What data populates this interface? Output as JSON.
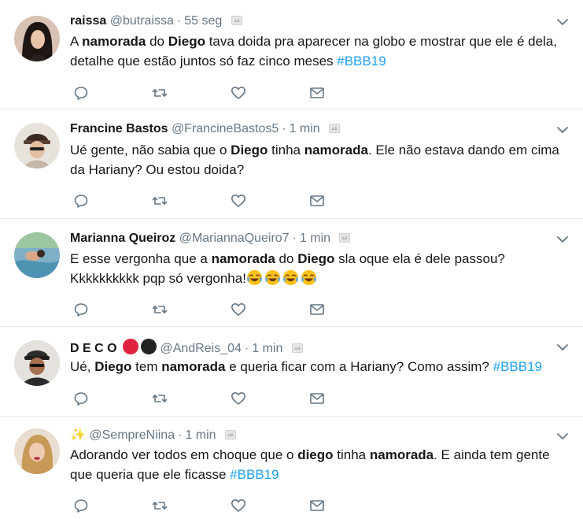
{
  "tweets": [
    {
      "name": "raissa",
      "handle": "@butraissa",
      "sep": "·",
      "time": "55 seg",
      "text": [
        {
          "t": "A "
        },
        {
          "b": "namorada"
        },
        {
          "t": " do "
        },
        {
          "b": "Diego"
        },
        {
          "t": " tava doida pra aparecer na globo e mostrar que ele é dela, detalhe que estão juntos só faz cinco meses "
        },
        {
          "h": "#BBB19"
        }
      ]
    },
    {
      "name": "Francine Bastos",
      "handle": "@FrancineBastos5",
      "sep": "·",
      "time": "1 min",
      "text": [
        {
          "t": "Ué gente, não sabia que o "
        },
        {
          "b": "Diego"
        },
        {
          "t": " tinha "
        },
        {
          "b": "namorada"
        },
        {
          "t": ". Ele não estava dando em cima da Hariany? Ou estou doida?"
        }
      ]
    },
    {
      "name": "Marianna Queiroz",
      "handle": "@MariannaQueiro7",
      "sep": "·",
      "time": "1 min",
      "text": [
        {
          "t": "E esse vergonha que a "
        },
        {
          "b": "namorada"
        },
        {
          "t": " do "
        },
        {
          "b": "Diego"
        },
        {
          "t": " sla oque ela é dele passou? Kkkkkkkkkk pqp só vergonha!"
        },
        {
          "e": "joy"
        },
        {
          "e": "joy"
        },
        {
          "e": "joy"
        },
        {
          "e": "joy"
        }
      ]
    },
    {
      "name": "D E C O",
      "name_emoji": [
        "#e0233f",
        "#222222"
      ],
      "handle": "@AndReis_04",
      "sep": "·",
      "time": "1 min",
      "text": [
        {
          "t": "Ué, "
        },
        {
          "b": "Diego"
        },
        {
          "t": " tem "
        },
        {
          "b": "namorada"
        },
        {
          "t": " e queria ficar com a Hariany? Como assim? "
        },
        {
          "h": "#BBB19"
        }
      ]
    },
    {
      "name": "✨",
      "handle": "@SempreNiina",
      "sep": "·",
      "time": "1 min",
      "text": [
        {
          "t": "Adorando ver todos em choque que o "
        },
        {
          "b": "diego"
        },
        {
          "t": " tinha "
        },
        {
          "b": "namorada"
        },
        {
          "t": ". E ainda tem gente que queria que ele ficasse "
        },
        {
          "h": "#BBB19"
        }
      ]
    }
  ],
  "colors": {
    "muted": "#657786",
    "hashtag": "#1da1f2",
    "divider": "#e6ecf0"
  },
  "icons": [
    "reply-icon",
    "retweet-icon",
    "like-icon",
    "direct-message-icon",
    "chevron-down-icon",
    "badge-icon"
  ]
}
